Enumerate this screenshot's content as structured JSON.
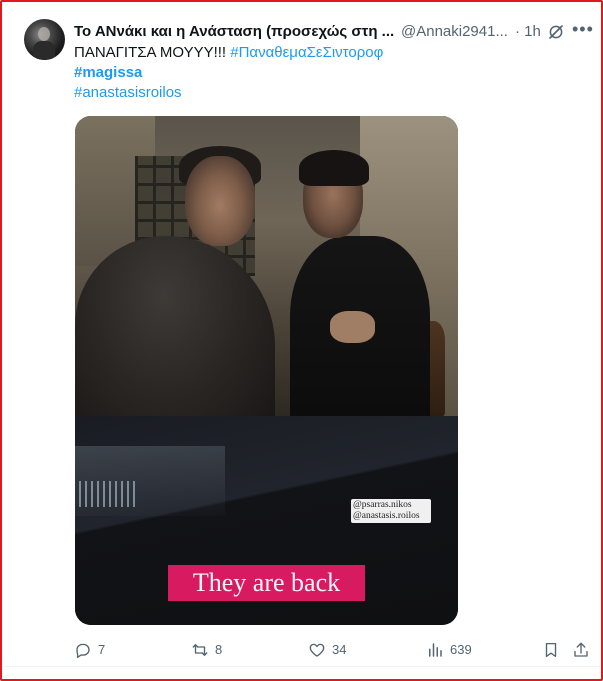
{
  "tweet": {
    "author_name": "Το ΑΝνάκι και η Ανάσταση (προσεχώς στη ...",
    "handle": "@Annaki2941...",
    "time": "· 1h",
    "more": "•••",
    "lines": [
      {
        "plain": "ΠΑΝΑΓΙΤΣΑ ΜΟΥΥΥ!!! ",
        "hashtag": "#ΠαναθεμαΣεΣιντοροφ"
      },
      {
        "hashtag": "#magissa"
      },
      {
        "hashtag": "#anastasisroilos"
      }
    ]
  },
  "media": {
    "tag_lines": [
      "@psarras.nikos",
      "@anastasis.roilos"
    ],
    "caption": "They are back"
  },
  "actions": {
    "replies": "7",
    "retweets": "8",
    "likes": "34",
    "views": "639"
  },
  "colors": {
    "link": "#1d9bf0",
    "muted": "#536471",
    "caption_bg": "#d81b60",
    "frame_border": "#e0191e"
  },
  "icons": {
    "reply": "reply-icon",
    "retweet": "retweet-icon",
    "like": "heart-icon",
    "views": "views-icon",
    "bookmark": "bookmark-icon",
    "share": "share-icon",
    "grok": "grok-icon"
  }
}
